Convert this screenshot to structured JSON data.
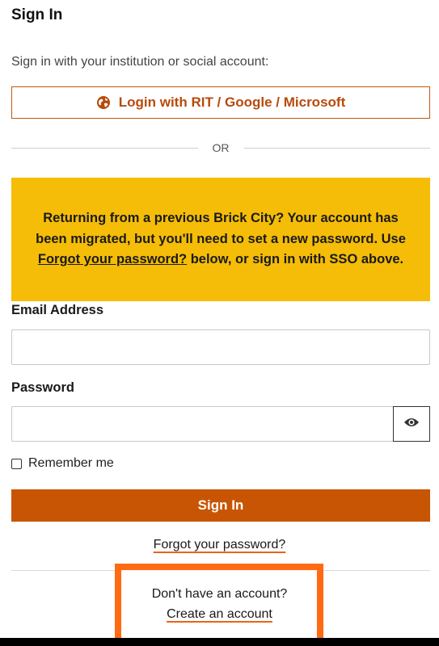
{
  "header": {
    "title": "Sign In",
    "subtitle": "Sign in with your institution or social account:"
  },
  "sso": {
    "label": "Login with RIT / Google / Microsoft",
    "icon": "globe-icon",
    "color": "#b84a0b"
  },
  "divider": {
    "text": "OR"
  },
  "notice": {
    "lead": "Returning from a previous Brick City?",
    "text_1": " Your account has been migrated, but you'll need to set a new password. Use ",
    "link": "Forgot your password?",
    "text_2": " below, or sign in with SSO above.",
    "background": "#f5bd07"
  },
  "form": {
    "email_label": "Email Address",
    "email_value": "",
    "password_label": "Password",
    "password_value": "",
    "show_password_icon": "eye-icon",
    "remember_label": "Remember me",
    "remember_checked": false,
    "submit_label": "Sign In",
    "submit_color": "#c85504"
  },
  "links": {
    "forgot": "Forgot your password?",
    "no_account": "Don't have an account?",
    "create": "Create an account"
  },
  "highlight_color": "#ff6a13"
}
